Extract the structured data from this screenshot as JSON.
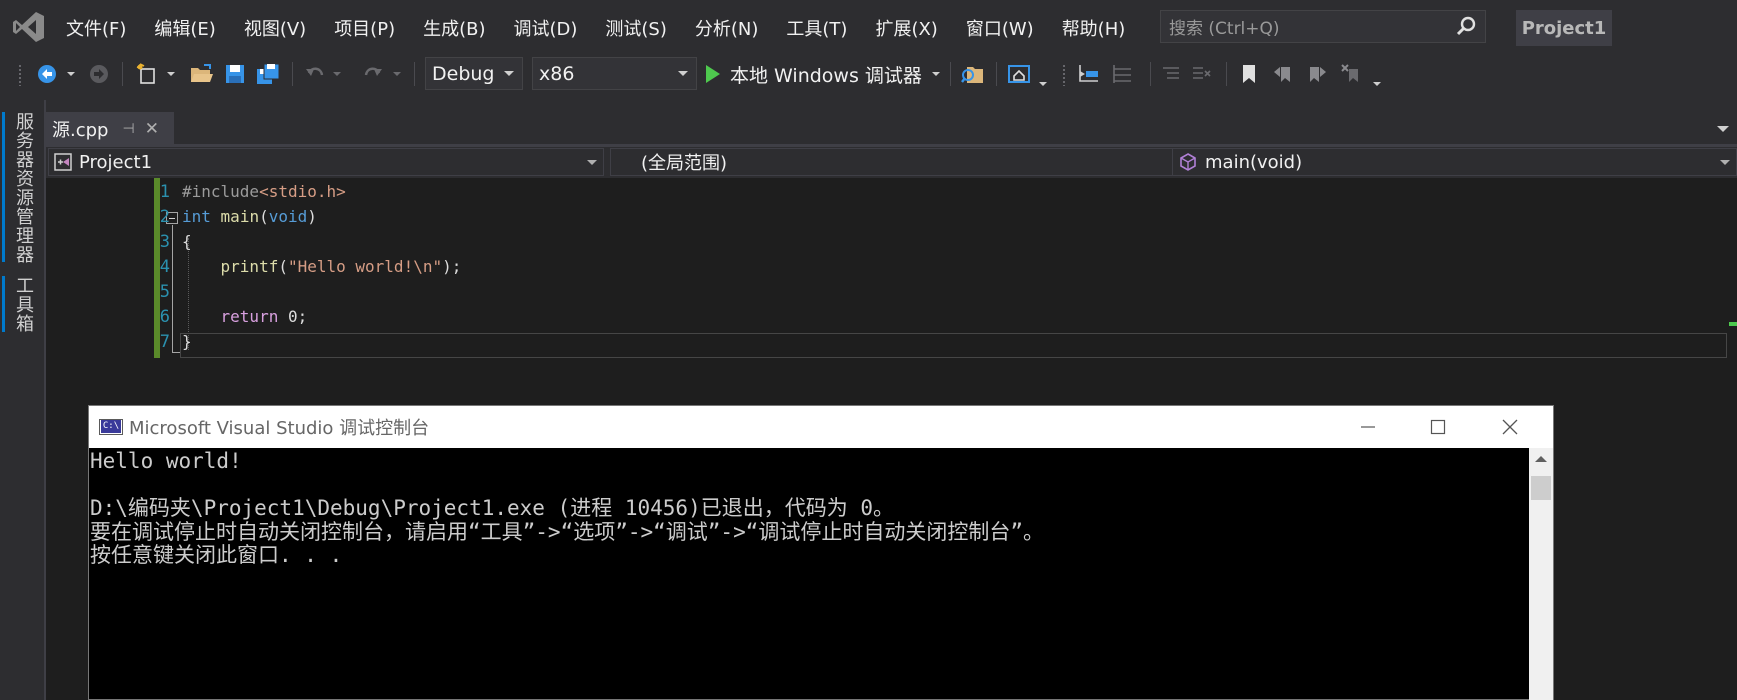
{
  "menubar": {
    "items": [
      "文件(F)",
      "编辑(E)",
      "视图(V)",
      "项目(P)",
      "生成(B)",
      "调试(D)",
      "测试(S)",
      "分析(N)",
      "工具(T)",
      "扩展(X)",
      "窗口(W)",
      "帮助(H)"
    ],
    "search_placeholder": "搜索 (Ctrl+Q)",
    "project_name": "Project1"
  },
  "toolbar": {
    "configuration": "Debug",
    "platform": "x86",
    "run_label": "本地 Windows 调试器"
  },
  "side_tabs": [
    "服务器资源管理器",
    "工具箱"
  ],
  "document": {
    "tab_name": "源.cpp",
    "nav_project": "Project1",
    "nav_scope": "(全局范围)",
    "nav_member": "main(void)"
  },
  "editor": {
    "line_numbers": [
      "1",
      "2",
      "3",
      "4",
      "5",
      "6",
      "7"
    ]
  },
  "console": {
    "title": "Microsoft Visual Studio 调试控制台",
    "lines": [
      "Hello world!",
      "",
      "D:\\编码夹\\Project1\\Debug\\Project1.exe (进程 10456)已退出，代码为 0。",
      "要在调试停止时自动关闭控制台，请启用“工具”->“选项”->“调试”->“调试停止时自动关闭控制台”。",
      "按任意键关闭此窗口. . ."
    ]
  },
  "colors": {
    "background": "#2d2d30",
    "editor_background": "#1e1e1e",
    "accent": "#007acc",
    "run_green": "#4ec94e",
    "keyword": "#569cd6",
    "string": "#d69d85",
    "line_number": "#2b91af"
  },
  "icons": [
    "visual-studio-logo",
    "search-icon",
    "back-icon",
    "forward-icon",
    "new-item-icon",
    "open-folder-icon",
    "save-icon",
    "save-all-icon",
    "undo-icon",
    "redo-icon",
    "play-icon",
    "find-in-files-icon",
    "solution-explorer-icon",
    "comment-icon",
    "bookmark-icon",
    "minimize-icon",
    "maximize-icon",
    "close-icon"
  ]
}
